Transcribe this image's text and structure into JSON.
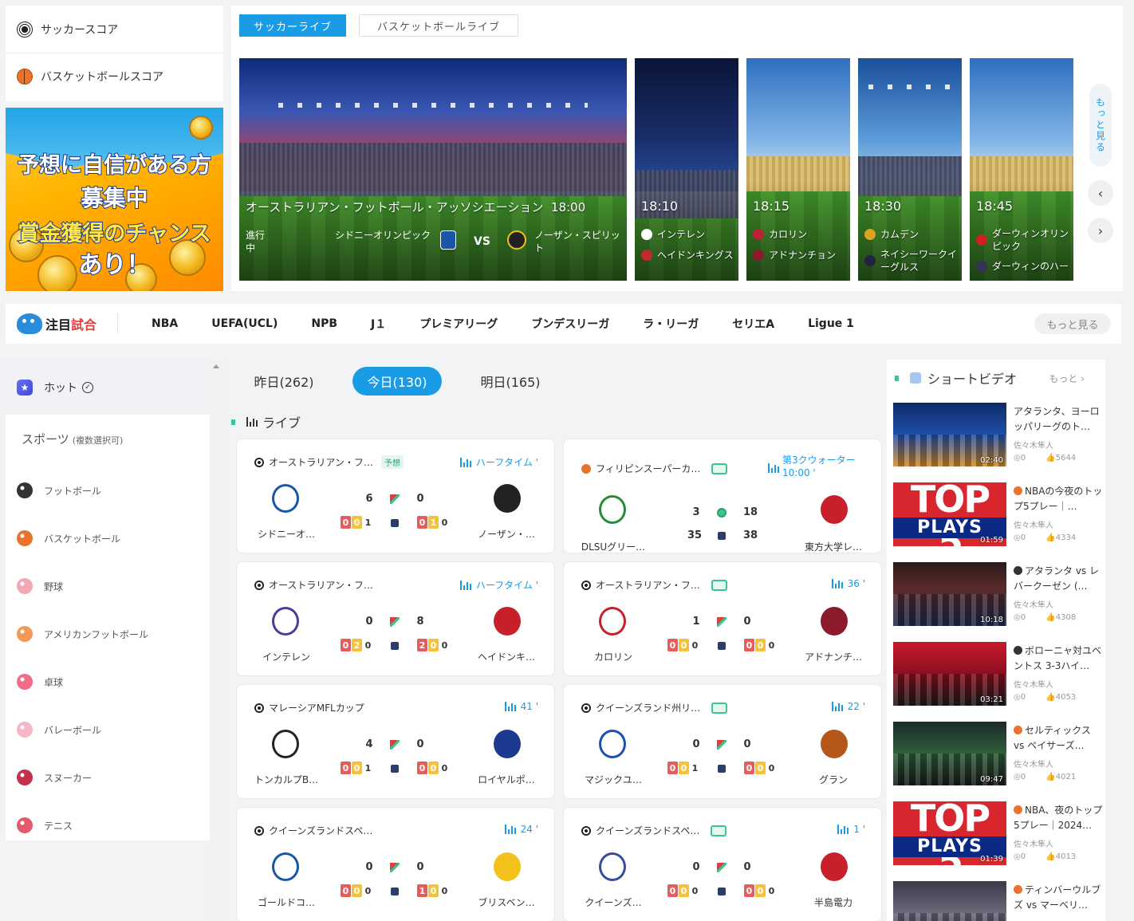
{
  "score_menu": [
    {
      "icon": "soccer-ball-icon",
      "label": "サッカースコア"
    },
    {
      "icon": "basketball-icon",
      "label": "バスケットボールスコア"
    }
  ],
  "banner": {
    "lines": [
      "予想に自信がある方",
      "募集中",
      "賞金獲得のチャンス",
      "あり！"
    ]
  },
  "live": {
    "tabs": [
      "サッカーライブ",
      "バスケットボールライブ"
    ],
    "active_tab": 0,
    "main": {
      "title": "オーストラリアン・フットボール・アッソシエーション",
      "time": "18:00",
      "status": "進行中",
      "home": "シドニーオリンピック",
      "vs": "VS",
      "away": "ノーザン・スピリット"
    },
    "side": [
      {
        "time": "18:10",
        "home": "インテレン",
        "away": "ヘイドンキングス"
      },
      {
        "time": "18:15",
        "home": "カロリン",
        "away": "アドナンチョン"
      },
      {
        "time": "18:30",
        "home": "カムデン",
        "away": "ネイシーワークイーグルス"
      },
      {
        "time": "18:45",
        "home": "ダーウィンオリンピック",
        "away": "ダーウィンのハー"
      }
    ],
    "more_label": "もっと見る",
    "prev_icon": "chevron-left-icon",
    "next_icon": "chevron-right-icon"
  },
  "nav": {
    "brand_a": "注目",
    "brand_b": "試合",
    "leagues": [
      "NBA",
      "UEFA(UCL)",
      "NPB",
      "J１",
      "プレミアリーグ",
      "ブンデスリーガ",
      "ラ・リーガ",
      "セリエA",
      "Ligue 1"
    ],
    "more": "もっと見る"
  },
  "sidebar": {
    "hot": "ホット",
    "sports_title": "スポーツ",
    "sports_note": "(複数選択可)",
    "sports": [
      {
        "label": "フットボール",
        "icon": "soccer-ball-icon",
        "color": "#333333"
      },
      {
        "label": "バスケットボール",
        "icon": "basketball-icon",
        "color": "#e8732c"
      },
      {
        "label": "野球",
        "icon": "baseball-icon",
        "color": "#f3a7b6"
      },
      {
        "label": "アメリカンフットボール",
        "icon": "american-football-icon",
        "color": "#f29a55"
      },
      {
        "label": "卓球",
        "icon": "table-tennis-icon",
        "color": "#f06d88"
      },
      {
        "label": "バレーボール",
        "icon": "volleyball-icon",
        "color": "#f5b6c6"
      },
      {
        "label": "スヌーカー",
        "icon": "snooker-icon",
        "color": "#c2304a"
      },
      {
        "label": "テニス",
        "icon": "tennis-icon",
        "color": "#e35a6a"
      }
    ]
  },
  "days": {
    "tabs": [
      "昨日(262)",
      "今日(130)",
      "明日(165)"
    ],
    "active": 1
  },
  "section": {
    "live_label": "ライブ"
  },
  "matches": [
    {
      "league": "オーストラリアン・フ…",
      "sport": "soccer",
      "badge": "予想",
      "status": "ハーフタイム '",
      "home": "シドニーオ…",
      "away": "ノーザン・…",
      "home_score": "6",
      "away_score": "0",
      "home_cards": [
        "0",
        "0",
        "1"
      ],
      "away_cards": [
        "0",
        "1",
        "0"
      ]
    },
    {
      "league": "フィリピンスーパーカ…",
      "sport": "basket",
      "badge": "tv",
      "status": "第3クウォーター 10:00 '",
      "home": "DLSUグリー…",
      "away": "東方大学レ…",
      "home_score": "3",
      "away_score": "18",
      "home_score2": "35",
      "away_score2": "38"
    },
    {
      "league": "オーストラリアン・フ…",
      "sport": "soccer",
      "badge": "",
      "status": "ハーフタイム '",
      "home": "インテレン",
      "away": "ヘイドンキ…",
      "home_score": "0",
      "away_score": "8",
      "home_cards": [
        "0",
        "2",
        "0"
      ],
      "away_cards": [
        "2",
        "0",
        "0"
      ]
    },
    {
      "league": "オーストラリアン・フ…",
      "sport": "soccer",
      "badge": "tv",
      "status": "36 '",
      "home": "カロリン",
      "away": "アドナンチ…",
      "home_score": "1",
      "away_score": "0",
      "home_cards": [
        "0",
        "0",
        "0"
      ],
      "away_cards": [
        "0",
        "0",
        "0"
      ]
    },
    {
      "league": "マレーシアMFLカップ",
      "sport": "soccer",
      "badge": "",
      "status": "41 '",
      "home": "トンカルプB…",
      "away": "ロイヤルポ…",
      "home_score": "4",
      "away_score": "0",
      "home_cards": [
        "0",
        "0",
        "1"
      ],
      "away_cards": [
        "0",
        "0",
        "0"
      ]
    },
    {
      "league": "クイーンズランド州リ…",
      "sport": "soccer",
      "badge": "tv",
      "status": "22 '",
      "home": "マジックユ…",
      "away": "グラン",
      "home_score": "0",
      "away_score": "0",
      "home_cards": [
        "0",
        "0",
        "1"
      ],
      "away_cards": [
        "0",
        "0",
        "0"
      ]
    },
    {
      "league": "クイーンズランドスペ…",
      "sport": "soccer",
      "badge": "",
      "status": "24 '",
      "home": "ゴールドコ…",
      "away": "ブリスベン…",
      "home_score": "0",
      "away_score": "0",
      "home_cards": [
        "0",
        "0",
        "0"
      ],
      "away_cards": [
        "1",
        "0",
        "0"
      ]
    },
    {
      "league": "クイーンズランドスペ…",
      "sport": "soccer",
      "badge": "tv",
      "status": "1 '",
      "home": "クイーンズ…",
      "away": "半島電力",
      "home_score": "0",
      "away_score": "0",
      "home_cards": [
        "0",
        "0",
        "0"
      ],
      "away_cards": [
        "0",
        "0",
        "0"
      ]
    }
  ],
  "videos": {
    "title": "ショートビデオ",
    "more": "もっと",
    "items": [
      {
        "title": "アタランタ、ヨーロッパリーグのト…",
        "author": "佐々木隼人",
        "duration": "02:40",
        "comments": "0",
        "likes": "5644",
        "kind": "photo"
      },
      {
        "title": "NBAの今夜のトップ5プレー｜…",
        "author": "佐々木隼人",
        "duration": "01:59",
        "comments": "0",
        "likes": "4334",
        "kind": "top5"
      },
      {
        "title": "アタランタ vs レバークーゼン (…",
        "author": "佐々木隼人",
        "duration": "10:18",
        "comments": "0",
        "likes": "4308",
        "kind": "photo"
      },
      {
        "title": "ボローニャ対ユベントス 3-3ハイ…",
        "author": "佐々木隼人",
        "duration": "03:21",
        "comments": "0",
        "likes": "4053",
        "kind": "photo"
      },
      {
        "title": "セルティックス vs ペイサーズ…",
        "author": "佐々木隼人",
        "duration": "09:47",
        "comments": "0",
        "likes": "4021",
        "kind": "photo"
      },
      {
        "title": "NBA、夜のトップ5プレー｜2024…",
        "author": "佐々木隼人",
        "duration": "01:39",
        "comments": "0",
        "likes": "4013",
        "kind": "top5"
      },
      {
        "title": "ティンバーウルブズ vs マーベリ…",
        "author": "",
        "duration": "",
        "comments": "",
        "likes": "",
        "kind": "photo"
      }
    ],
    "top5_big": "TOP 5",
    "top5_plays": "PLAYS"
  }
}
